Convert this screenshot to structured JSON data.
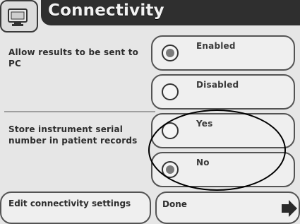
{
  "header": {
    "title": "Connectivity",
    "icon": "pc-monitor-icon"
  },
  "sections": {
    "results": {
      "label": "Allow results to be sent to PC",
      "options": [
        {
          "label": "Enabled",
          "selected": true
        },
        {
          "label": "Disabled",
          "selected": false
        }
      ]
    },
    "serial": {
      "label": "Store instrument serial number in patient records",
      "options": [
        {
          "label": "Yes",
          "selected": false
        },
        {
          "label": "No",
          "selected": true
        }
      ]
    }
  },
  "footer": {
    "edit_label": "Edit connectivity settings",
    "done_label": "Done",
    "next_icon": "right-arrow-icon"
  }
}
